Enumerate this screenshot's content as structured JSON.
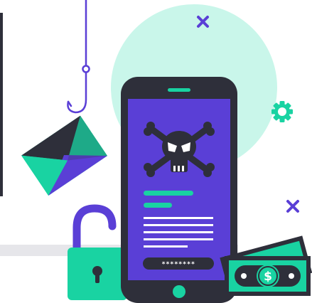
{
  "illustration": {
    "colors": {
      "circle": "#c9f6ea",
      "primary_dark": "#2e2f3a",
      "accent_purple": "#5a3fd6",
      "accent_teal": "#19d3a2",
      "phone_screen": "#5a3fd6",
      "white": "#ffffff",
      "floor_gray": "#e6e6ea"
    },
    "phone": {
      "password_mask": "********",
      "icon": "skull-crossbones-icon"
    },
    "money": {
      "currency_symbol": "$"
    },
    "icons": [
      "envelope-icon",
      "fishing-hook-icon",
      "open-padlock-icon",
      "skull-crossbones-icon",
      "banknote-icon",
      "gear-icon",
      "close-icon"
    ]
  }
}
